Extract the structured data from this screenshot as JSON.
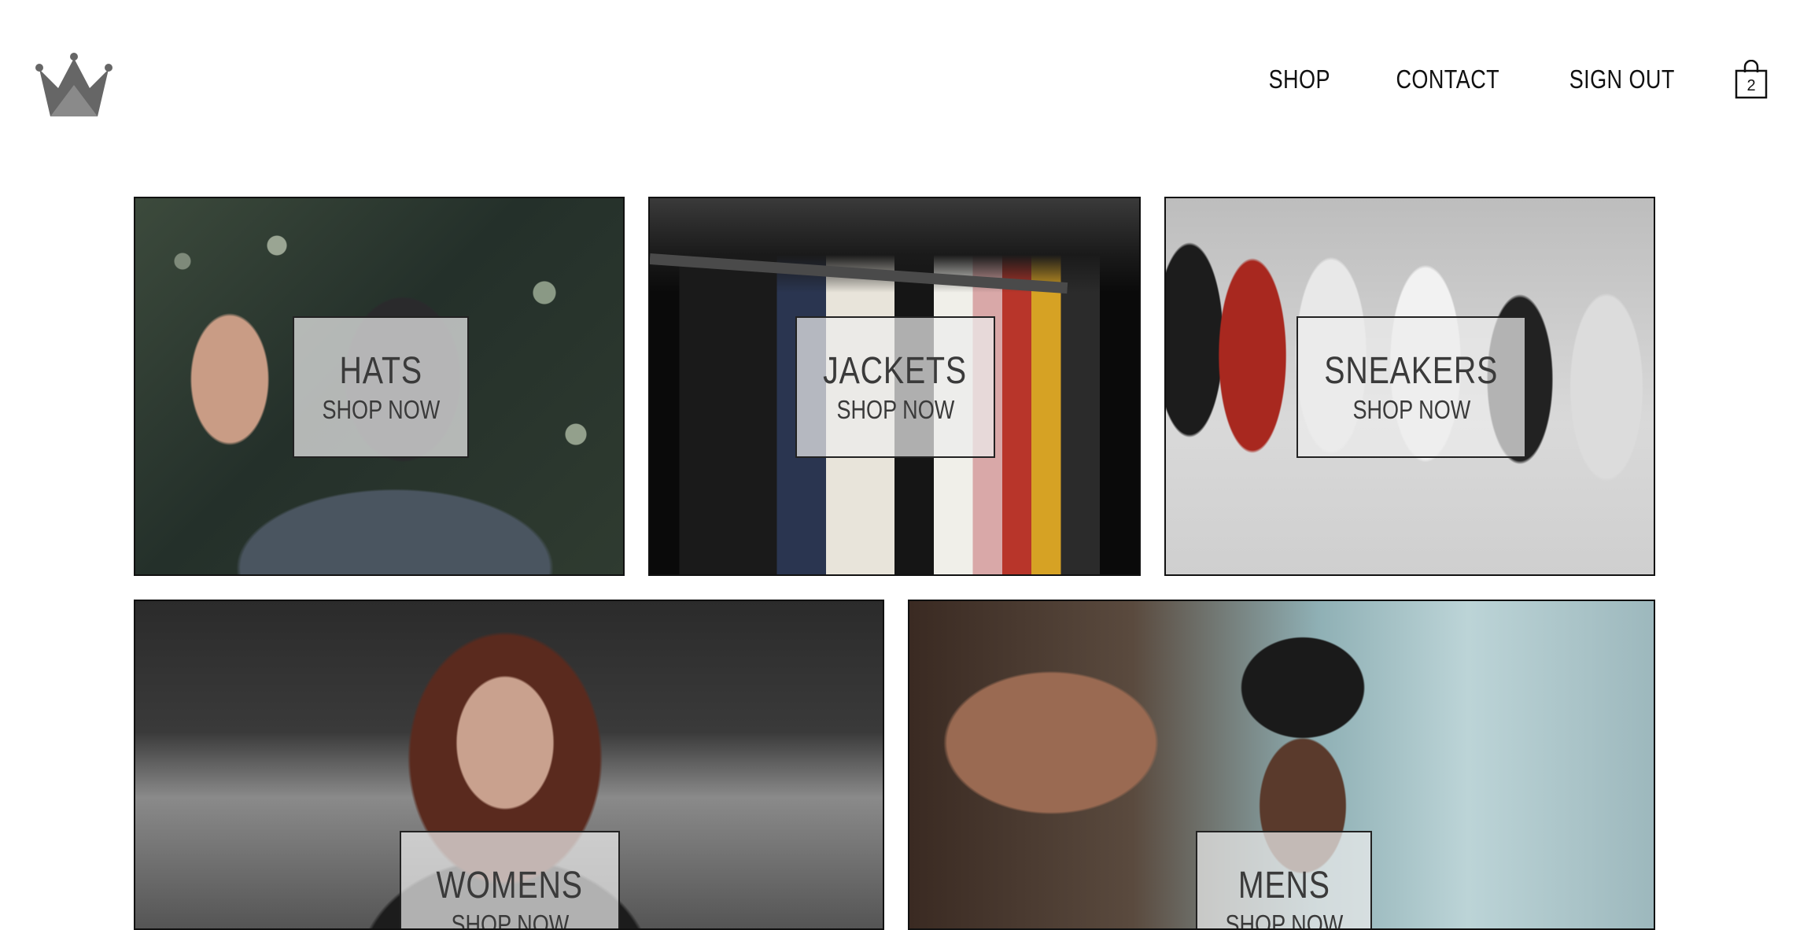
{
  "header": {
    "logo_icon": "crown-icon",
    "nav": {
      "shop": "SHOP",
      "contact": "CONTACT",
      "sign_out": "SIGN OUT"
    },
    "cart": {
      "icon": "shopping-bag-icon",
      "count": "2"
    }
  },
  "directory": {
    "items": [
      {
        "title": "HATS",
        "subtitle": "SHOP NOW"
      },
      {
        "title": "JACKETS",
        "subtitle": "SHOP NOW"
      },
      {
        "title": "SNEAKERS",
        "subtitle": "SHOP NOW"
      },
      {
        "title": "WOMENS",
        "subtitle": "SHOP NOW"
      },
      {
        "title": "MENS",
        "subtitle": "SHOP NOW"
      }
    ]
  },
  "colors": {
    "logo": "#666666",
    "border": "#111111",
    "overlay": "#ebebeb"
  }
}
